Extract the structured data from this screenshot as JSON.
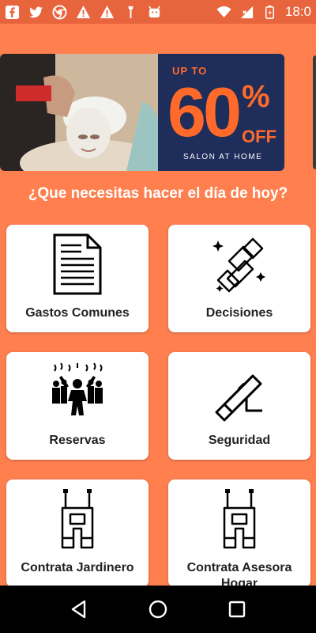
{
  "status_bar": {
    "time": "18:0",
    "icons": [
      "facebook-icon",
      "twitter-icon",
      "chrome-icon",
      "alert-icon",
      "alert-icon",
      "bluetooth-icon",
      "android-icon",
      "wifi-icon",
      "signal-icon",
      "battery-icon"
    ]
  },
  "banner": {
    "up_to": "UP TO",
    "percent_value": "60",
    "percent_sign": "%",
    "off": "OFF",
    "tagline": "SALON AT HOME"
  },
  "question": "¿Que necesitas hacer el día de hoy?",
  "cards": [
    {
      "label": "Gastos Comunes",
      "icon": "document-icon"
    },
    {
      "label": "Decisiones",
      "icon": "handshake-icon"
    },
    {
      "label": "Reservas",
      "icon": "crowd-icon"
    },
    {
      "label": "Seguridad",
      "icon": "flashlight-icon"
    },
    {
      "label": "Contrata Jardinero",
      "icon": "overalls-icon"
    },
    {
      "label": "Contrata Asesora Hogar",
      "icon": "overalls-icon"
    }
  ],
  "nav": {
    "icons": [
      "back-icon",
      "home-icon",
      "recents-icon"
    ]
  },
  "colors": {
    "background": "#FF7F4F",
    "status_bar": "#E8643C",
    "promo_bg": "#1F2D5A",
    "promo_accent": "#FF6A2A"
  }
}
